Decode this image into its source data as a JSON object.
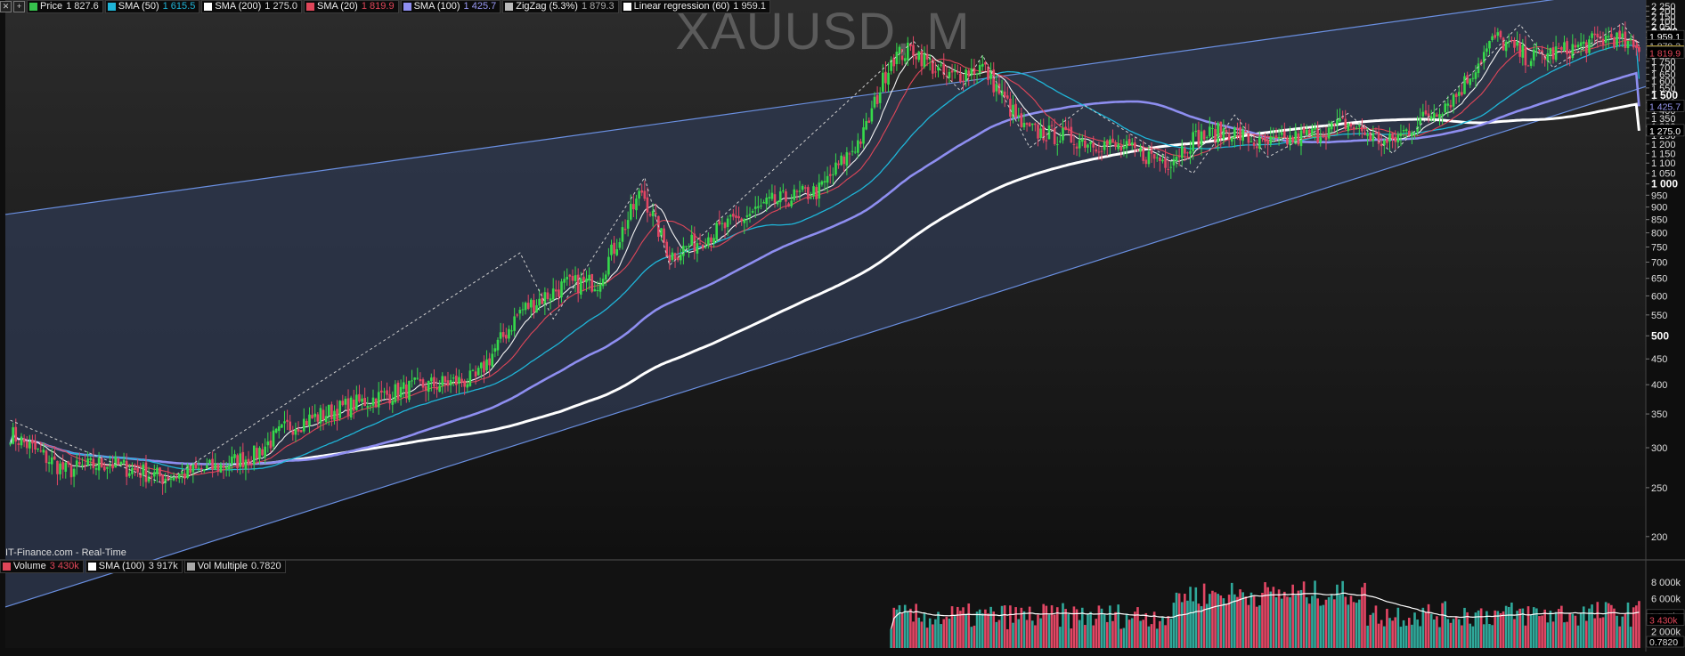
{
  "legend": {
    "items": [
      {
        "name": "Price",
        "value": "1 827.6",
        "color": "#36c24d",
        "value_color": "#dddddd"
      },
      {
        "name": "SMA (50)",
        "value": "1 615.5",
        "color": "#1fb5d8",
        "value_color": "#1fb5d8"
      },
      {
        "name": "SMA (200)",
        "value": "1 275.0",
        "color": "#ffffff",
        "value_color": "#dddddd"
      },
      {
        "name": "SMA (20)",
        "value": "1 819.9",
        "color": "#e04659",
        "value_color": "#e04659"
      },
      {
        "name": "SMA (100)",
        "value": "1 425.7",
        "color": "#8e8ef0",
        "value_color": "#9a9af5"
      },
      {
        "name": "ZigZag (5.3%)",
        "value": "1 879.3",
        "color": "#bbbbbb",
        "value_color": "#aaaaaa"
      },
      {
        "name": "Linear regression (60)",
        "value": "1 959.1",
        "color": "#ffffff",
        "value_color": "#dddddd"
      }
    ]
  },
  "volume_legend": {
    "items": [
      {
        "name": "Volume",
        "value": "3 430k",
        "color": "#e04659",
        "value_color": "#e04659"
      },
      {
        "name": "SMA (100)",
        "value": "3 917k",
        "color": "#ffffff",
        "value_color": "#dddddd"
      },
      {
        "name": "Vol Multiple",
        "value": "0.7820",
        "color": "#aaaaaa",
        "value_color": "#dddddd"
      }
    ]
  },
  "title": "XAUUSD, M",
  "source": "IT-Finance.com - Real-Time",
  "colors": {
    "up": "#36d94b",
    "down": "#e24664",
    "sma20": "#e04659",
    "sma50": "#1fb5d8",
    "sma100": "#8e8ef0",
    "sma200": "#ffffff",
    "channel": "#6a8fe0",
    "channel_fill": "#2f3a52",
    "price_tag": "#f2c100"
  },
  "chart_data": [
    {
      "type": "candlestick",
      "title": "XAUUSD, M",
      "y_scale": "log",
      "ylim": [
        185,
        2260
      ],
      "y_ticks": [
        "2 250",
        "2 200",
        "2 150",
        "2 100",
        "2 050",
        "2 000",
        "1 950",
        "1 900",
        "1 850",
        "1 800",
        "1 750",
        "1 700",
        "1 650",
        "1 600",
        "1 550",
        "1 500",
        "1 450",
        "1 400",
        "1 350",
        "1 300",
        "1 250",
        "1 200",
        "1 150",
        "1 100",
        "1 050",
        "1 000",
        "950",
        "900",
        "850",
        "800",
        "750",
        "700",
        "650",
        "600",
        "550",
        "500",
        "450",
        "400",
        "350",
        "300",
        "250",
        "200"
      ],
      "bold_ticks": [
        "2 000",
        "1 500",
        "1 000",
        "500"
      ],
      "price_series": [
        {
          "idx": 0,
          "close": 320
        },
        {
          "idx": 20,
          "close": 270
        },
        {
          "idx": 35,
          "close": 280
        },
        {
          "idx": 55,
          "close": 262
        },
        {
          "idx": 75,
          "close": 275
        },
        {
          "idx": 88,
          "close": 290
        },
        {
          "idx": 100,
          "close": 330
        },
        {
          "idx": 120,
          "close": 360
        },
        {
          "idx": 145,
          "close": 395
        },
        {
          "idx": 168,
          "close": 410
        },
        {
          "idx": 184,
          "close": 560
        },
        {
          "idx": 200,
          "close": 630
        },
        {
          "idx": 212,
          "close": 640
        },
        {
          "idx": 228,
          "close": 970
        },
        {
          "idx": 238,
          "close": 720
        },
        {
          "idx": 252,
          "close": 790
        },
        {
          "idx": 275,
          "close": 920
        },
        {
          "idx": 292,
          "close": 970
        },
        {
          "idx": 308,
          "close": 1250
        },
        {
          "idx": 318,
          "close": 1780
        },
        {
          "idx": 326,
          "close": 1850
        },
        {
          "idx": 338,
          "close": 1620
        },
        {
          "idx": 351,
          "close": 1710
        },
        {
          "idx": 366,
          "close": 1280
        },
        {
          "idx": 395,
          "close": 1200
        },
        {
          "idx": 418,
          "close": 1110
        },
        {
          "idx": 427,
          "close": 1230
        },
        {
          "idx": 440,
          "close": 1280
        },
        {
          "idx": 452,
          "close": 1190
        },
        {
          "idx": 472,
          "close": 1260
        },
        {
          "idx": 482,
          "close": 1320
        },
        {
          "idx": 497,
          "close": 1200
        },
        {
          "idx": 508,
          "close": 1320
        },
        {
          "idx": 522,
          "close": 1500
        },
        {
          "idx": 536,
          "close": 1950
        },
        {
          "idx": 548,
          "close": 1780
        },
        {
          "idx": 562,
          "close": 1840
        },
        {
          "idx": 578,
          "close": 1960
        },
        {
          "idx": 588,
          "close": 1827.6
        }
      ],
      "zigzag": [
        {
          "idx": 0,
          "value": 340
        },
        {
          "idx": 55,
          "value": 255
        },
        {
          "idx": 184,
          "value": 730
        },
        {
          "idx": 196,
          "value": 540
        },
        {
          "idx": 229,
          "value": 1030
        },
        {
          "idx": 238,
          "value": 690
        },
        {
          "idx": 326,
          "value": 1920
        },
        {
          "idx": 343,
          "value": 1530
        },
        {
          "idx": 351,
          "value": 1800
        },
        {
          "idx": 368,
          "value": 1180
        },
        {
          "idx": 388,
          "value": 1430
        },
        {
          "idx": 427,
          "value": 1050
        },
        {
          "idx": 442,
          "value": 1370
        },
        {
          "idx": 454,
          "value": 1130
        },
        {
          "idx": 483,
          "value": 1380
        },
        {
          "idx": 499,
          "value": 1150
        },
        {
          "idx": 545,
          "value": 2070
        },
        {
          "idx": 557,
          "value": 1700
        },
        {
          "idx": 582,
          "value": 2080
        },
        {
          "idx": 588,
          "value": 1879.3
        }
      ],
      "indicators": {
        "sma20_last": 1819.9,
        "sma50_last": 1615.5,
        "sma100_last": 1425.7,
        "sma200_last": 1275.0,
        "linear_regression_last": 1959.1,
        "price_last": 1827.6
      },
      "axis_tags": [
        {
          "value": 1959.1,
          "label": "1 959.1",
          "bg": "#000000",
          "fg": "#ffffff"
        },
        {
          "value": 1879.3,
          "label": "1 879.3",
          "bg": "#000000",
          "fg": "#bbbbbb"
        },
        {
          "value": 1827.6,
          "label": "1 827.6",
          "bg": "#f2c100",
          "fg": "#000000"
        },
        {
          "value": 1819.9,
          "label": "1 819.9",
          "bg": "#000000",
          "fg": "#e04659"
        },
        {
          "value": 1425.7,
          "label": "1 425.7",
          "bg": "#000000",
          "fg": "#9a9af5"
        },
        {
          "value": 1275.0,
          "label": "1 275.0",
          "bg": "#000000",
          "fg": "#ffffff"
        }
      ]
    },
    {
      "type": "bar",
      "title": "Volume",
      "ylim": [
        0,
        9000
      ],
      "y_ticks": [
        "8 000k",
        "6 000k",
        "2 000k"
      ],
      "sma100_last": "3 917k",
      "last_volume": "3 430k",
      "vol_multiple": "0.7820",
      "bars_start_idx": 318
    }
  ]
}
